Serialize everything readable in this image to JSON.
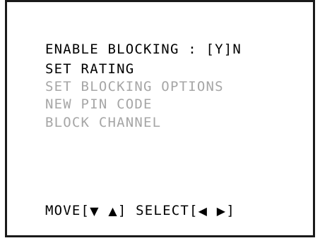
{
  "menu": {
    "enable_blocking": "ENABLE BLOCKING : [Y]N",
    "set_rating": "SET RATING",
    "set_blocking_options": "SET BLOCKING OPTIONS",
    "new_pin_code": "NEW PIN CODE",
    "block_channel": "BLOCK CHANNEL"
  },
  "footer": {
    "move_label": "MOVE[",
    "down_arrow": "▼",
    "up_arrow": "▲",
    "move_close": "] SELECT[",
    "left_arrow": "◀",
    "right_arrow": "▶",
    "select_close": "]"
  },
  "colors": {
    "active_text": "#000000",
    "disabled_text": "#a6a6a6",
    "frame": "#1a1a1a",
    "background": "#ffffff"
  },
  "icons": [
    "arrow-down-icon",
    "arrow-up-icon",
    "arrow-left-icon",
    "arrow-right-icon"
  ]
}
